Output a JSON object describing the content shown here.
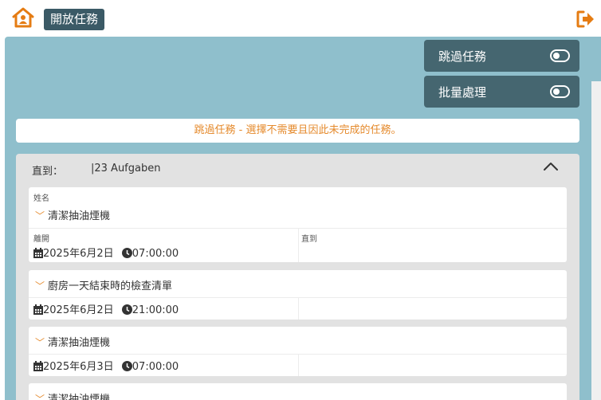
{
  "header": {
    "title": "開放任務",
    "home_icon": "home-icon",
    "logout_icon": "logout-icon",
    "accent": "#e57c13",
    "badge_color": "#3b5a66"
  },
  "toggles": [
    {
      "label": "跳過任務",
      "on": false
    },
    {
      "label": "批量處理",
      "on": false
    }
  ],
  "info_text": "跳過任務 - 選擇不需要且因此未完成的任務。",
  "group": {
    "label": "直到：",
    "count": "|23 Aufgaben"
  },
  "cards": [
    {
      "name_label": "姓名",
      "name": "清潔抽油煙機",
      "start_label": "離開",
      "end_label": "直到",
      "date": "2025年6月2日",
      "time": "07:00:00"
    },
    {
      "name": "廚房一天結束時的檢查清單",
      "date": "2025年6月2日",
      "time": "21:00:00"
    },
    {
      "name": "清潔抽油煙機",
      "date": "2025年6月3日",
      "time": "07:00:00"
    },
    {
      "name": "清潔抽油煙機"
    }
  ]
}
